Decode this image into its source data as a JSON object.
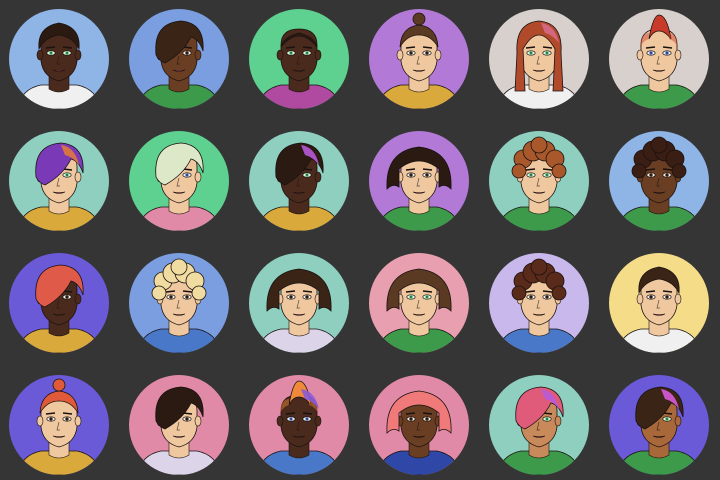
{
  "palette": {
    "page_background": "#353535",
    "shirt_colors": [
      "#f0f0f0",
      "#d9a93c",
      "#3c9a4a",
      "#b04aa0",
      "#e08aa8",
      "#4a78c8",
      "#dcd4e8",
      "#2f48a8"
    ]
  },
  "avatars": [
    {
      "bg": "#8fb4e6",
      "skin": "#4a2a1c",
      "hair": "#2a1a12",
      "hair_style": "short-top",
      "hair_accent": "",
      "eyes": "#3cc870",
      "shirt": "#f0f0f0",
      "lips": "#b04a6a"
    },
    {
      "bg": "#7a9ee0",
      "skin": "#6a3e22",
      "hair": "#3a2416",
      "hair_style": "side-swept",
      "hair_accent": "",
      "eyes": "#3a2416",
      "shirt": "#3c9a4a",
      "lips": "#c0508a"
    },
    {
      "bg": "#5ed090",
      "skin": "#4a2a1c",
      "hair": "#2a1a12",
      "hair_style": "buzz",
      "hair_accent": "",
      "eyes": "#3cc870",
      "shirt": "#b04aa0",
      "lips": "#5a2a22"
    },
    {
      "bg": "#b27ad6",
      "skin": "#f0c8a0",
      "hair": "#5a3a22",
      "hair_style": "top-bun",
      "hair_accent": "",
      "eyes": "#3a2416",
      "shirt": "#d9a93c",
      "lips": "#c07a6a"
    },
    {
      "bg": "#d8d0cc",
      "skin": "#f0c8a0",
      "hair": "#b04a2a",
      "hair_style": "long",
      "hair_accent": "#d86a8a",
      "eyes": "#3cc870",
      "shirt": "#f0f0f0",
      "lips": "#c0706a"
    },
    {
      "bg": "#d8d0cc",
      "skin": "#f0c8a0",
      "hair": "#c83a2a",
      "hair_style": "mohawk",
      "hair_accent": "",
      "eyes": "#4a6ad8",
      "shirt": "#3c9a4a",
      "lips": "#c0706a"
    },
    {
      "bg": "#8fcfc0",
      "skin": "#f0c8a0",
      "hair": "#7a3ab8",
      "hair_style": "side-swept",
      "hair_accent": "#e07a3a",
      "eyes": "#3cc870",
      "shirt": "#d9a93c",
      "lips": "#a04a5a"
    },
    {
      "bg": "#5ed090",
      "skin": "#f0c8a0",
      "hair": "#dce8c8",
      "hair_style": "side-swept",
      "hair_accent": "",
      "eyes": "#4a78c8",
      "shirt": "#e08aa8",
      "lips": "#c0706a"
    },
    {
      "bg": "#8fcfc0",
      "skin": "#4a2a1c",
      "hair": "#2a1a12",
      "hair_style": "side-swept",
      "hair_accent": "#b85ad8",
      "eyes": "#3cc870",
      "shirt": "#d9a93c",
      "lips": "#5a2a22"
    },
    {
      "bg": "#b27ad6",
      "skin": "#f0c8a0",
      "hair": "#2a1a12",
      "hair_style": "bob",
      "hair_accent": "",
      "eyes": "#3a2416",
      "shirt": "#3c9a4a",
      "lips": "#c0706a"
    },
    {
      "bg": "#8fcfc0",
      "skin": "#f0c8a0",
      "hair": "#a8582a",
      "hair_style": "curly",
      "hair_accent": "",
      "eyes": "#3cc870",
      "shirt": "#3c9a4a",
      "lips": "#c0706a"
    },
    {
      "bg": "#8fb4e6",
      "skin": "#6a3e22",
      "hair": "#3a1e14",
      "hair_style": "curly",
      "hair_accent": "",
      "eyes": "#3a2416",
      "shirt": "#3c9a4a",
      "lips": "#5a2a22"
    },
    {
      "bg": "#6a5ad8",
      "skin": "#4a2a1c",
      "hair": "#e05a4a",
      "hair_style": "side-swept",
      "hair_accent": "",
      "eyes": "#3a2416",
      "shirt": "#d9a93c",
      "lips": "#5a2a22"
    },
    {
      "bg": "#7a9ee0",
      "skin": "#f0c8a0",
      "hair": "#f0dca0",
      "hair_style": "curly",
      "hair_accent": "",
      "eyes": "#3a2416",
      "shirt": "#4a78c8",
      "lips": "#c0706a"
    },
    {
      "bg": "#8fcfc0",
      "skin": "#f0c8a0",
      "hair": "#3a2416",
      "hair_style": "bob",
      "hair_accent": "",
      "eyes": "#3a2416",
      "shirt": "#dcd4e8",
      "lips": "#c0507a"
    },
    {
      "bg": "#e8a0b0",
      "skin": "#f0c8a0",
      "hair": "#5a3a22",
      "hair_style": "bob",
      "hair_accent": "",
      "eyes": "#3cc870",
      "shirt": "#3c9a4a",
      "lips": "#c0706a"
    },
    {
      "bg": "#c8b8ec",
      "skin": "#f0c8a0",
      "hair": "#5a2a1a",
      "hair_style": "curly",
      "hair_accent": "",
      "eyes": "#3a2416",
      "shirt": "#4a78c8",
      "lips": "#c0706a"
    },
    {
      "bg": "#f4dc88",
      "skin": "#f0c8a0",
      "hair": "#3a2416",
      "hair_style": "short-top",
      "hair_accent": "",
      "eyes": "#3a2416",
      "shirt": "#f0f0f0",
      "lips": "#c0507a"
    },
    {
      "bg": "#6a5ad8",
      "skin": "#f0c8a0",
      "hair": "#e05a3a",
      "hair_style": "top-bun",
      "hair_accent": "",
      "eyes": "#3a2416",
      "shirt": "#d9a93c",
      "lips": "#c0706a"
    },
    {
      "bg": "#e08aa8",
      "skin": "#f0c8a0",
      "hair": "#2a1a12",
      "hair_style": "side-swept",
      "hair_accent": "",
      "eyes": "#3a2416",
      "shirt": "#dcd4e8",
      "lips": "#c0706a"
    },
    {
      "bg": "#e08aa8",
      "skin": "#4a2a1c",
      "hair": "#f08a3a",
      "hair_style": "mohawk",
      "hair_accent": "#8a5ad8",
      "eyes": "#5a7ad8",
      "shirt": "#4a78c8",
      "lips": "#5a2a22"
    },
    {
      "bg": "#e08aa8",
      "skin": "#6a3e22",
      "hair": "#f07a7a",
      "hair_style": "bob",
      "hair_accent": "",
      "eyes": "#3a2416",
      "shirt": "#2f48a8",
      "lips": "#5a2a22"
    },
    {
      "bg": "#8fcfc0",
      "skin": "#c88a5a",
      "hair": "#e05a7a",
      "hair_style": "side-swept",
      "hair_accent": "#b85ad8",
      "eyes": "#3cc870",
      "shirt": "#3c9a4a",
      "lips": "#a04a5a"
    },
    {
      "bg": "#6a5ad8",
      "skin": "#a8683a",
      "hair": "#3a2416",
      "hair_style": "side-swept",
      "hair_accent": "#d85ad8",
      "eyes": "#3cc870",
      "shirt": "#3c9a4a",
      "lips": "#7a3a2a"
    }
  ]
}
